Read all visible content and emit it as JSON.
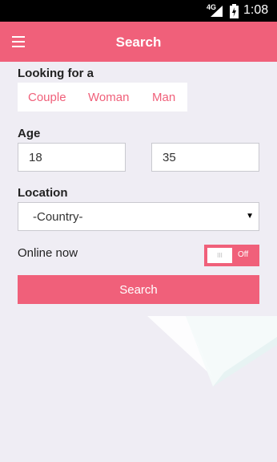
{
  "status_bar": {
    "network": "4G",
    "time": "1:08"
  },
  "app_bar": {
    "title": "Search"
  },
  "looking_for": {
    "label": "Looking for a",
    "options": [
      "Couple",
      "Woman",
      "Man"
    ]
  },
  "age": {
    "label": "Age",
    "min": "18",
    "max": "35"
  },
  "location": {
    "label": "Location",
    "selected": "-Country-"
  },
  "online": {
    "label": "Online now",
    "toggle_text": "Off",
    "knob_text": "III",
    "value": false
  },
  "search_button": {
    "label": "Search"
  },
  "colors": {
    "accent": "#f0607a",
    "background": "#efedf4"
  }
}
